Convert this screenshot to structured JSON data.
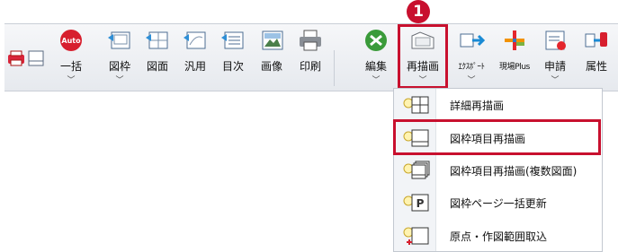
{
  "colors": {
    "accent": "#c8102e"
  },
  "step_badge": "1",
  "toolbar": {
    "buttons": [
      {
        "id": "ikkatsu",
        "label": "一括",
        "badge": "Auto",
        "icon": "auto-icon",
        "dropdown": "﹀"
      },
      {
        "id": "zuwaku",
        "label": "図枠",
        "icon": "frame-icon",
        "dropdown": "﹀"
      },
      {
        "id": "zumen",
        "label": "図面",
        "icon": "drawing-icon"
      },
      {
        "id": "hanyou",
        "label": "汎用",
        "icon": "generic-icon"
      },
      {
        "id": "mokuji",
        "label": "目次",
        "icon": "index-icon"
      },
      {
        "id": "gazou",
        "label": "画像",
        "icon": "image-icon"
      },
      {
        "id": "insatsu",
        "label": "印刷",
        "icon": "printer-icon"
      },
      {
        "id": "henshuu",
        "label": "編集",
        "icon": "edit-tools-icon",
        "dropdown": "﹀"
      },
      {
        "id": "saibyoga",
        "label": "再描画",
        "icon": "redraw-icon",
        "dropdown": "﹀"
      },
      {
        "id": "export",
        "label": "ｴｸｽﾎﾟｰﾄ",
        "icon": "export-icon",
        "dropdown": "﹀"
      },
      {
        "id": "genbaplus",
        "label": "現場Plus",
        "icon": "genba-plus-icon"
      },
      {
        "id": "shinsei",
        "label": "申請",
        "icon": "application-icon",
        "dropdown": "﹀"
      },
      {
        "id": "zokusei",
        "label": "属性",
        "icon": "attribute-icon"
      }
    ]
  },
  "menu": {
    "items": [
      {
        "label": "詳細再描画",
        "icon": "detail-redraw-icon"
      },
      {
        "label": "図枠項目再描画",
        "icon": "frame-item-redraw-icon"
      },
      {
        "label": "図枠項目再描画(複数図面)",
        "icon": "multi-frame-redraw-icon"
      },
      {
        "label": "図枠ページ一括更新",
        "icon": "page-batch-update-icon"
      },
      {
        "label": "原点・作図範囲取込",
        "icon": "origin-import-icon"
      }
    ]
  }
}
